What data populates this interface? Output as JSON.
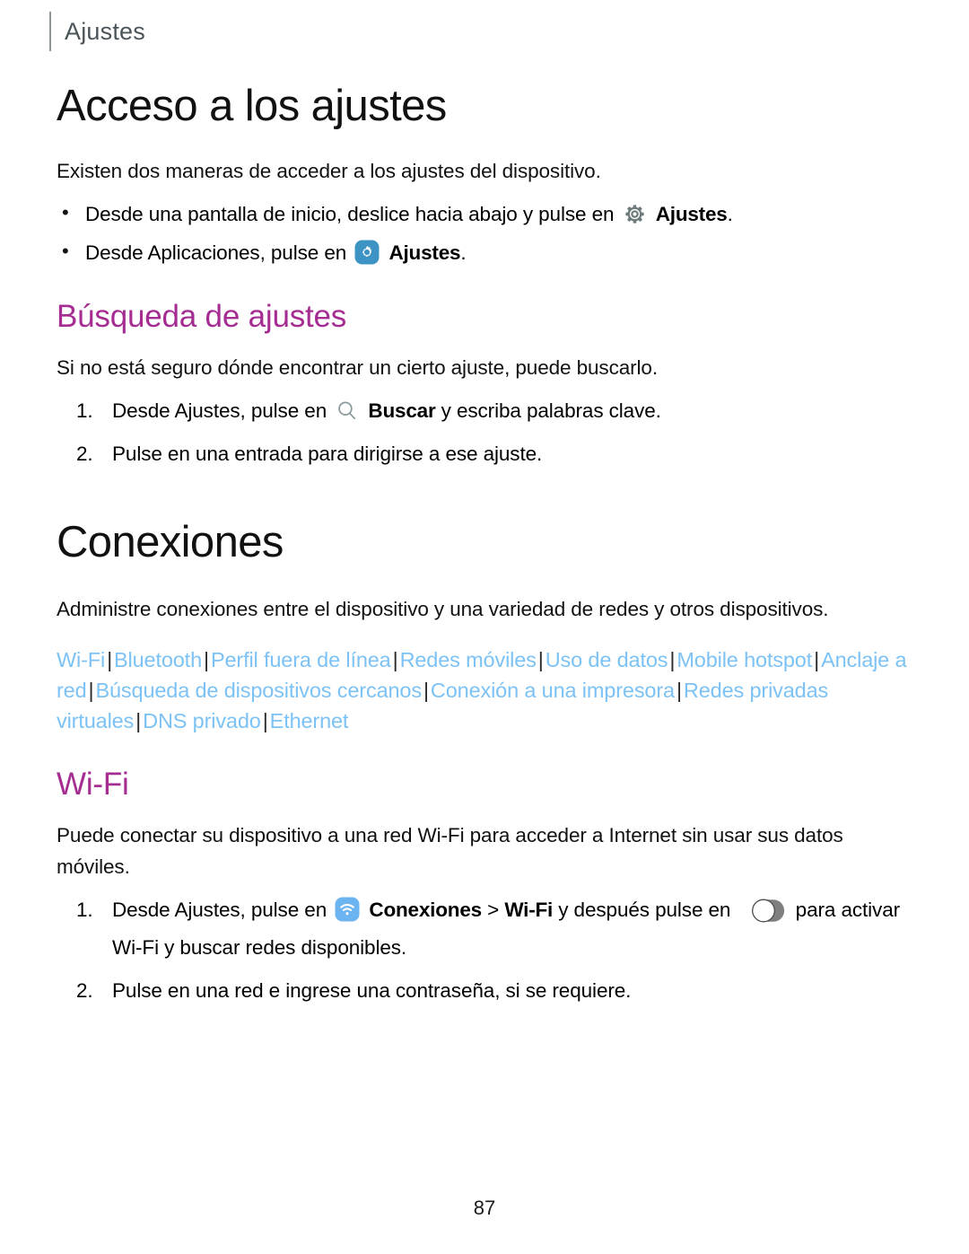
{
  "header": {
    "label": "Ajustes"
  },
  "section_settings_access": {
    "title": "Acceso a los ajustes",
    "intro": "Existen dos maneras de acceder a los ajustes del dispositivo.",
    "bullets": [
      {
        "text_before": "Desde una pantalla de inicio, deslice hacia abajo y pulse en",
        "icon": "gear-icon-gray",
        "ui_label": "Ajustes",
        "text_after": "."
      },
      {
        "text_before": "Desde Aplicaciones, pulse en",
        "icon": "gear-icon-blue-app",
        "ui_label": "Ajustes",
        "text_after": "."
      }
    ]
  },
  "section_settings_search": {
    "title": "Búsqueda de ajustes",
    "intro": "Si no está seguro dónde encontrar un cierto ajuste, puede buscarlo.",
    "steps": [
      {
        "text_before": "Desde Ajustes, pulse en",
        "icon": "search-icon",
        "ui_label": "Buscar",
        "text_after": "y escriba palabras clave."
      },
      {
        "text_before": "Pulse en una entrada para dirigirse a ese ajuste.",
        "icon": "",
        "ui_label": "",
        "text_after": ""
      }
    ]
  },
  "section_connections": {
    "title": "Conexiones",
    "intro": "Administre conexiones entre el dispositivo y una variedad de redes y otros dispositivos.",
    "links": [
      "Wi-Fi",
      "Bluetooth",
      "Perfil fuera de línea",
      "Redes móviles",
      "Uso de datos",
      "Mobile hotspot",
      "Anclaje a red",
      "Búsqueda de dispositivos cercanos",
      "Conexión a una impresora",
      "Redes privadas virtuales",
      "DNS privado",
      "Ethernet"
    ],
    "link_separator": "|"
  },
  "section_wifi": {
    "title": "Wi-Fi",
    "intro": "Puede conectar su dispositivo a una red Wi-Fi para acceder a Internet sin usar sus datos móviles.",
    "step1": {
      "part1": "Desde Ajustes, pulse en",
      "icon": "wifi-icon-blue-app",
      "ui_label1": "Conexiones",
      "chevron": ">",
      "ui_label2": "Wi-Fi",
      "part2": "y después pulse en",
      "toggle": "toggle-switch-off",
      "part3": "para activar Wi-Fi y buscar redes disponibles."
    },
    "step2": "Pulse en una red e ingrese una contraseña, si se requiere."
  },
  "footer": {
    "page_number": "87"
  },
  "colors": {
    "heading_accent": "#a52d92",
    "link": "#7cc2f5",
    "header_text": "#4b5559",
    "gear_gray": "#6d7a7c",
    "app_icon_blue": "#3d94c4",
    "wifi_icon_blue": "#6cb4f0",
    "toggle_track": "#7f7f7f"
  }
}
